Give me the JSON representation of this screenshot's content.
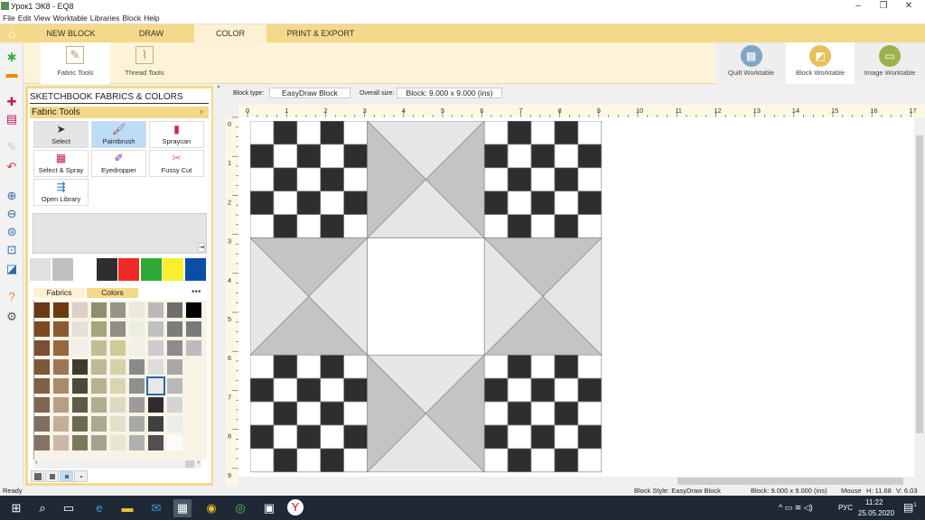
{
  "window": {
    "title": "Урок1 ЭК8 - EQ8",
    "minimize": "–",
    "restore": "❐",
    "close": "✕"
  },
  "menu": [
    "File",
    "Edit",
    "View",
    "Worktable",
    "Libraries",
    "Block",
    "Help"
  ],
  "tabs": [
    {
      "label": "NEW BLOCK"
    },
    {
      "label": "DRAW"
    },
    {
      "label": "COLOR",
      "active": true
    },
    {
      "label": "PRINT & EXPORT"
    }
  ],
  "ribbon": {
    "left": [
      {
        "label": "Fabric Tools",
        "selected": true
      },
      {
        "label": "Thread Tools"
      }
    ],
    "right": [
      {
        "label": "Quilt Worktable",
        "color": "#7fa6c4"
      },
      {
        "label": "Block Worktable",
        "color": "#e8c15a",
        "selected": true
      },
      {
        "label": "Image Worktable",
        "color": "#9cb34d"
      }
    ]
  },
  "panel": {
    "title": "SKETCHBOOK FABRICS & COLORS",
    "dropdown": "Fabric Tools",
    "tools": [
      {
        "label": "Select",
        "icon": "cursor"
      },
      {
        "label": "Paintbrush",
        "icon": "paintbrush",
        "selected": true
      },
      {
        "label": "Spraycan",
        "icon": "spraycan"
      },
      {
        "label": "Select & Spray",
        "icon": "select-spray"
      },
      {
        "label": "Eyedropper",
        "icon": "eyedropper"
      },
      {
        "label": "Fussy Cut",
        "icon": "fussy-cut"
      },
      {
        "label": "Open Library",
        "icon": "open-library"
      }
    ],
    "recent_colors": [
      "#e0e0e0",
      "#c0c0c0",
      "#ffffff",
      "#2e2e2e",
      "#ee2a24",
      "#2eaa34",
      "#f8f02a",
      "#0a4ea8"
    ],
    "subtabs": [
      {
        "label": "Fabrics"
      },
      {
        "label": "Colors",
        "active": true
      }
    ],
    "more": "•••",
    "palette": [
      [
        "#6b3a14",
        "#6e3a0c",
        "#ddd0c6",
        "#8e8f70",
        "#95958a",
        "#ebe9dc",
        "#b9b9b9",
        "#6e6e6e",
        "#000000"
      ],
      [
        "#7a4a22",
        "#8a5a32",
        "#e6e0da",
        "#a5a47e",
        "#8f8f88",
        "#eceee2",
        "#c0c0c0",
        "#7d7d7d",
        "#7a7a7a"
      ],
      [
        "#7a5030",
        "#956840",
        "#f3efea",
        "#c0be96",
        "#cfcb96",
        "#f0efe8",
        "#cccccc",
        "#8c8c8c",
        "#bcbcbc"
      ],
      [
        "#7a5838",
        "#9e7656",
        "#3c3c30",
        "#bcb994",
        "#d4d2a8",
        "#8a8a8a",
        "#dcdcdc",
        "#a8a8a8",
        null
      ],
      [
        "#7e6044",
        "#aa8a6c",
        "#4c4a3a",
        "#b4b290",
        "#d8d6b2",
        "#909090",
        "#e8e8e8",
        "#b8b8b8",
        null
      ],
      [
        "#806650",
        "#b89e86",
        "#5c5c48",
        "#b0ae92",
        "#dcdac0",
        "#9c9c9c",
        "#2e2e2e",
        "#d4d4d4",
        null
      ],
      [
        "#806e5e",
        "#c4ae98",
        "#6a6a50",
        "#aaa890",
        "#e2e0c8",
        "#a8a8a8",
        "#404040",
        "#ececec",
        null
      ],
      [
        "#847468",
        "#ccb8a8",
        "#7a7a5a",
        "#a4a48e",
        "#e8e6d0",
        "#b0b0b0",
        "#505050",
        "#fcfcfc",
        null
      ]
    ],
    "selected_swatch": {
      "row": 4,
      "col": 6
    }
  },
  "canvas": {
    "block_type_label": "Block type:",
    "block_type": "EasyDraw Block",
    "overall_size_label": "Overall size:",
    "overall_size": "Block: 9.000 x 9.000 (ins)",
    "ruler_h": [
      "0",
      "1",
      "2",
      "3",
      "4",
      "5",
      "6",
      "7",
      "8",
      "9",
      "10",
      "11",
      "12",
      "13",
      "14",
      "15",
      "16",
      "17"
    ],
    "ruler_v": [
      "0",
      "1",
      "2",
      "3",
      "4",
      "5",
      "6",
      "7",
      "8",
      "9"
    ],
    "colors": {
      "dark": "#2e2e2e",
      "white": "#ffffff",
      "gray": "#c4c4c4",
      "light": "#e6e6e6"
    }
  },
  "status": {
    "left": "Ready",
    "style": "Block Style: EasyDraw Block",
    "block": "Block: 9.000 x 9.000 (ins)",
    "mouse": "Mouse",
    "h": "H: 11.68",
    "v": "V: 6.03"
  },
  "taskbar": {
    "lang": "РУС",
    "time": "11:22",
    "date": "25.05.2020",
    "notifications": "1"
  }
}
